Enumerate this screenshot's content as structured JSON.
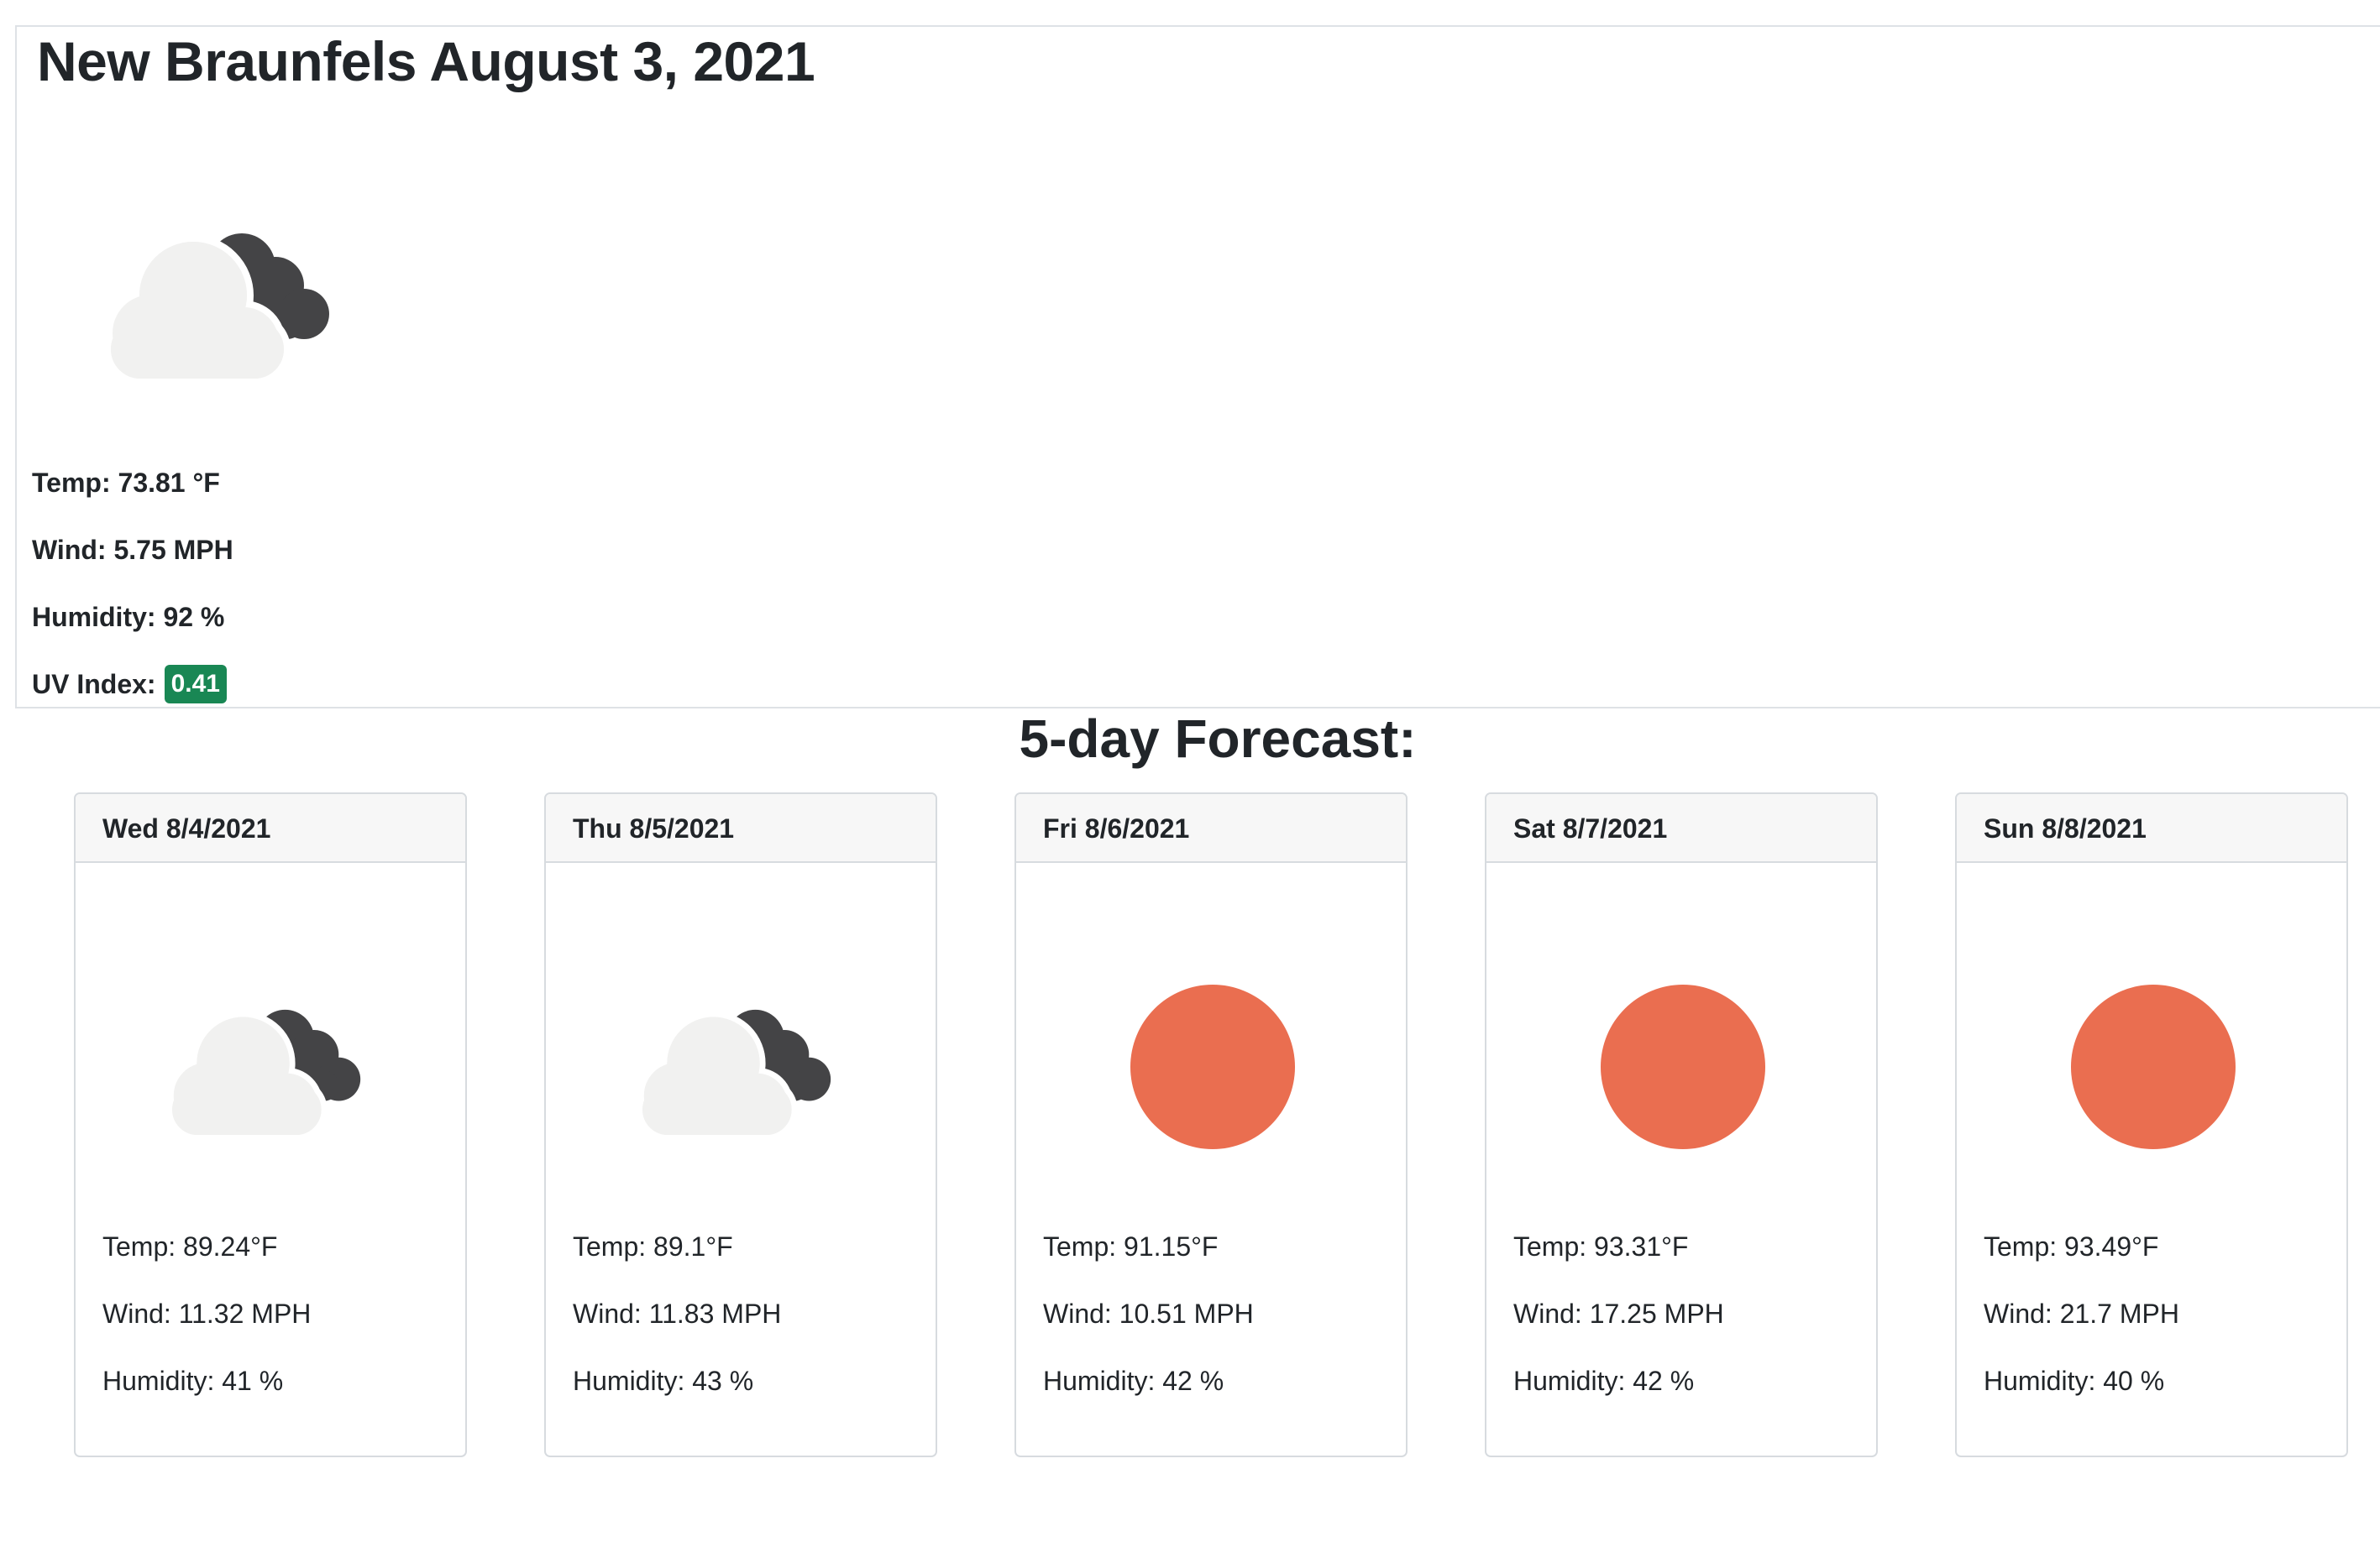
{
  "current": {
    "title": "New Braunfels August 3, 2021",
    "icon": "cloudy-night-icon",
    "temp": "Temp: 73.81 °F",
    "wind": "Wind: 5.75 MPH",
    "humidity": "Humidity: 92 %",
    "uv_label": "UV Index:",
    "uv_value": "0.41",
    "uv_color": "#198754"
  },
  "forecast_heading": "5-day Forecast:",
  "forecast": [
    {
      "date": "Wed 8/4/2021",
      "icon": "cloudy-night-icon",
      "temp": "Temp: 89.24°F",
      "wind": "Wind: 11.32 MPH",
      "humidity": "Humidity: 41 %"
    },
    {
      "date": "Thu 8/5/2021",
      "icon": "cloudy-night-icon",
      "temp": "Temp: 89.1°F",
      "wind": "Wind: 11.83 MPH",
      "humidity": "Humidity: 43 %"
    },
    {
      "date": "Fri 8/6/2021",
      "icon": "sun-icon",
      "temp": "Temp: 91.15°F",
      "wind": "Wind: 10.51 MPH",
      "humidity": "Humidity: 42 %"
    },
    {
      "date": "Sat 8/7/2021",
      "icon": "sun-icon",
      "temp": "Temp: 93.31°F",
      "wind": "Wind: 17.25 MPH",
      "humidity": "Humidity: 42 %"
    },
    {
      "date": "Sun 8/8/2021",
      "icon": "sun-icon",
      "temp": "Temp: 93.49°F",
      "wind": "Wind: 21.7 MPH",
      "humidity": "Humidity: 40 %"
    }
  ],
  "colors": {
    "sun": "#ea6e50",
    "cloud": "#f1f1f0",
    "cloud_dark": "#444446"
  }
}
